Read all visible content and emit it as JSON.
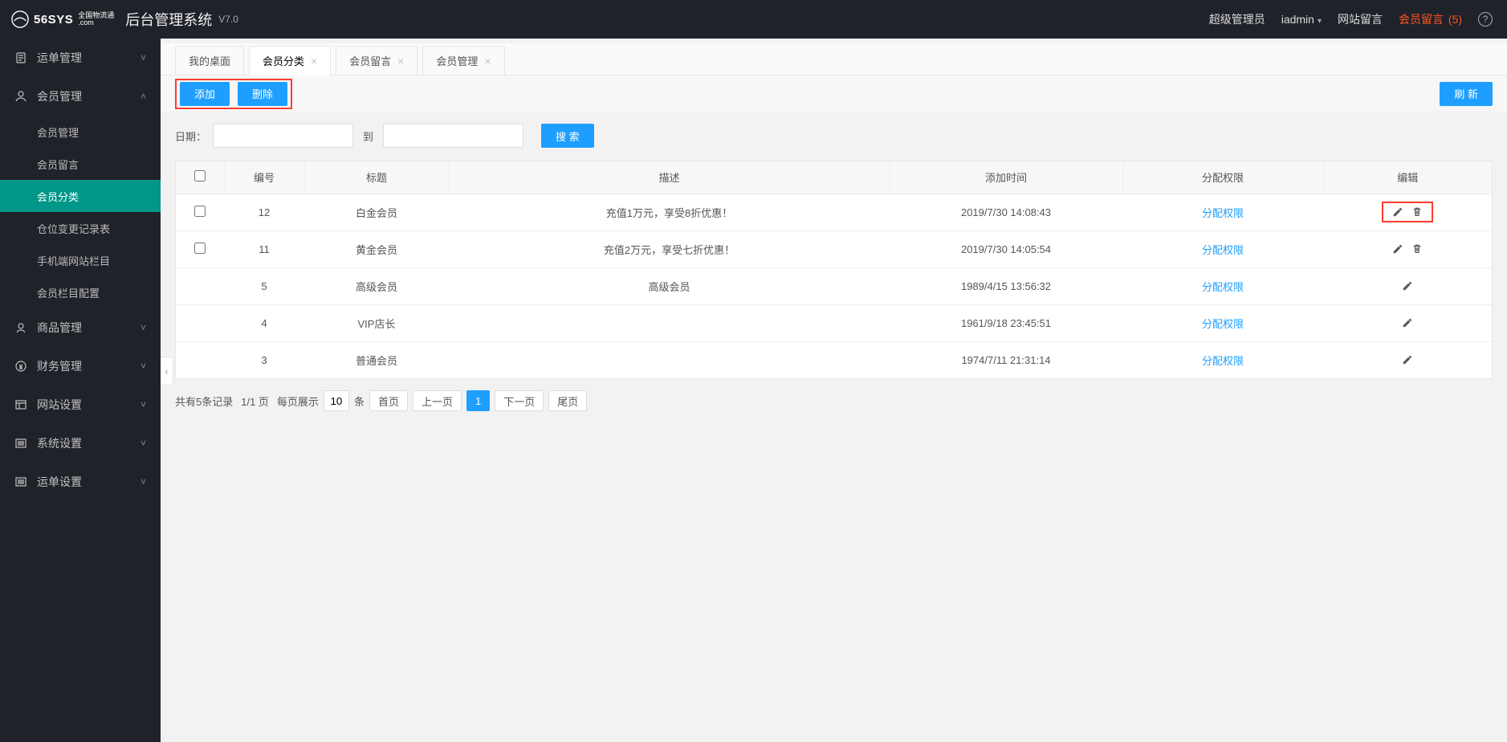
{
  "header": {
    "logo_main": "56SYS",
    "logo_sub_top": "全国物流通",
    "logo_sub_bottom": ".com",
    "app_title": "后台管理系统",
    "version": "V7.0",
    "role": "超级管理员",
    "user": "iadmin",
    "site_msg": "网站留言",
    "member_msg": "会员留言",
    "member_msg_count": "(5)"
  },
  "sidebar": {
    "items": [
      {
        "label": "运单管理",
        "icon": "doc"
      },
      {
        "label": "会员管理",
        "icon": "user",
        "expanded": true,
        "children": [
          {
            "label": "会员管理"
          },
          {
            "label": "会员留言"
          },
          {
            "label": "会员分类",
            "active": true
          },
          {
            "label": "仓位变更记录表"
          },
          {
            "label": "手机端网站栏目"
          },
          {
            "label": "会员栏目配置"
          }
        ]
      },
      {
        "label": "商品管理",
        "icon": "head"
      },
      {
        "label": "财务管理",
        "icon": "money"
      },
      {
        "label": "网站设置",
        "icon": "layout"
      },
      {
        "label": "系统设置",
        "icon": "list"
      },
      {
        "label": "运单设置",
        "icon": "list"
      }
    ]
  },
  "tabs": [
    {
      "label": "我的桌面",
      "closable": false
    },
    {
      "label": "会员分类",
      "closable": true,
      "active": true
    },
    {
      "label": "会员留言",
      "closable": true
    },
    {
      "label": "会员管理",
      "closable": true
    }
  ],
  "toolbar": {
    "add": "添加",
    "delete": "删除",
    "refresh": "刷 新"
  },
  "search": {
    "date_label": "日期：",
    "to": "到",
    "search_btn": "搜 索"
  },
  "table": {
    "headers": {
      "id": "编号",
      "title": "标题",
      "desc": "描述",
      "time": "添加时间",
      "auth": "分配权限",
      "edit": "编辑"
    },
    "auth_link": "分配权限",
    "rows": [
      {
        "id": "12",
        "title": "白金会员",
        "desc": "充值1万元，享受8折优惠！",
        "time": "2019/7/30 14:08:43",
        "checkable": true,
        "deletable": true,
        "highlight": true
      },
      {
        "id": "11",
        "title": "黄金会员",
        "desc": "充值2万元，享受七折优惠！",
        "time": "2019/7/30 14:05:54",
        "checkable": true,
        "deletable": true
      },
      {
        "id": "5",
        "title": "高级会员",
        "desc": "高级会员",
        "time": "1989/4/15 13:56:32",
        "checkable": false,
        "deletable": false
      },
      {
        "id": "4",
        "title": "VIP店长",
        "desc": "",
        "time": "1961/9/18 23:45:51",
        "checkable": false,
        "deletable": false
      },
      {
        "id": "3",
        "title": "普通会员",
        "desc": "",
        "time": "1974/7/11 21:31:14",
        "checkable": false,
        "deletable": false
      }
    ]
  },
  "pagination": {
    "total": "共有5条记录",
    "pages": "1/1 页",
    "per_label_left": "每页展示",
    "page_size": "10",
    "per_label_right": "条",
    "first": "首页",
    "prev": "上一页",
    "page1": "1",
    "next": "下一页",
    "last": "尾页"
  }
}
